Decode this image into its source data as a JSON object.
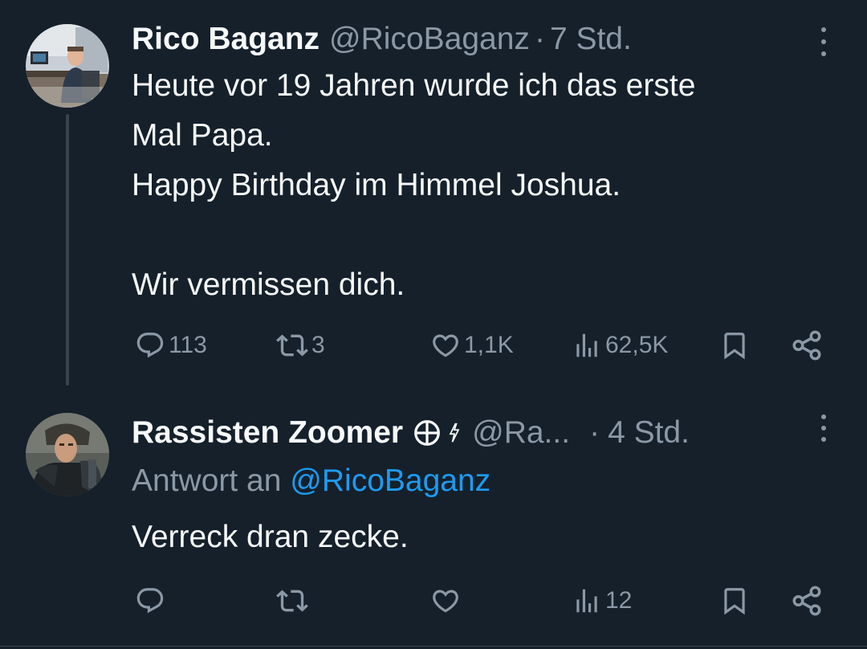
{
  "tweets": [
    {
      "author": {
        "display_name": "Rico Baganz",
        "handle": "@RicoBaganz",
        "avatar_icon": "profile-photo-man-at-desk"
      },
      "separator": "·",
      "time": "7 Std.",
      "text_lines": [
        "Heute vor 19 Jahren wurde ich das erste",
        "Mal Papa.",
        "Happy Birthday im Himmel Joshua.",
        "",
        "Wir vermissen dich."
      ],
      "actions": {
        "replies": "113",
        "reposts": "3",
        "likes": "1,1K",
        "views": "62,5K"
      }
    },
    {
      "author": {
        "display_name": "Rassisten Zoomer",
        "handle": "@Ra...",
        "avatar_icon": "profile-photo-armored-man",
        "badge_icon": "circled-cross-icon",
        "flash_icon": "lightning-icon"
      },
      "separator": "·",
      "time": "4 Std.",
      "reply_to_label": "Antwort an",
      "reply_to_handle": "@RicoBaganz",
      "text_lines": [
        "Verreck dran zecke."
      ],
      "actions": {
        "replies": "",
        "reposts": "",
        "likes": "",
        "views": "12"
      }
    }
  ],
  "colors": {
    "background": "#15202b",
    "primary_text": "#f7f9f9",
    "secondary_text": "#8b98a5",
    "link": "#1d9bf0",
    "divider": "#38444d"
  }
}
